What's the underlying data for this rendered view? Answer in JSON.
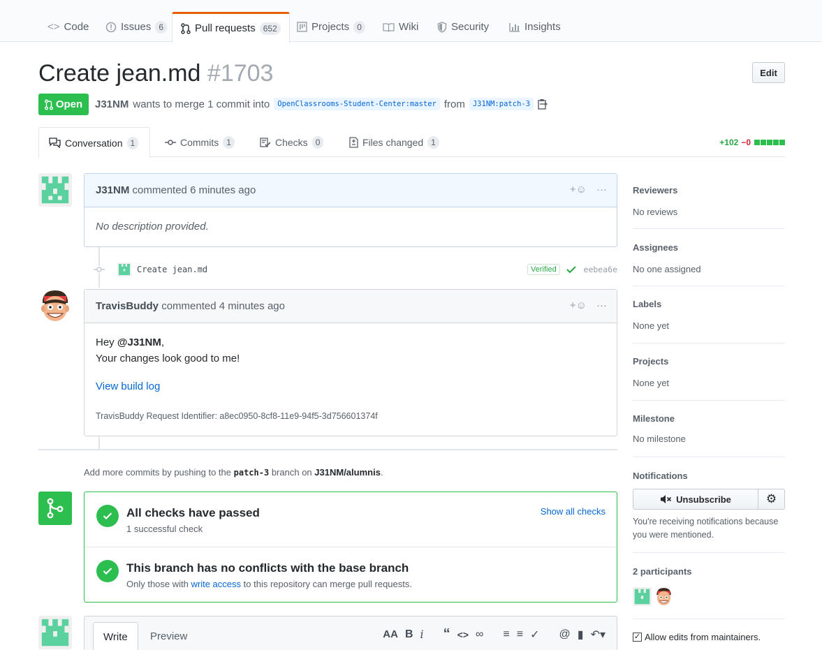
{
  "repo_nav": {
    "tabs": [
      {
        "label": "Code",
        "count": ""
      },
      {
        "label": "Issues",
        "count": "6"
      },
      {
        "label": "Pull requests",
        "count": "652"
      },
      {
        "label": "Projects",
        "count": "0"
      },
      {
        "label": "Wiki",
        "count": ""
      },
      {
        "label": "Security",
        "count": ""
      },
      {
        "label": "Insights",
        "count": ""
      }
    ],
    "selected": "Pull requests",
    "accent_color": "#e36209"
  },
  "pr": {
    "title": "Create jean.md",
    "number": "#1703",
    "edit_label": "Edit",
    "state": "Open",
    "author": "J31NM",
    "meta_text": "wants to merge 1 commit into",
    "base_ref": "OpenClassrooms-Student-Center:master",
    "from_text": "from",
    "head_ref": "J31NM:patch-3"
  },
  "pr_tabs": [
    {
      "label": "Conversation",
      "count": "1"
    },
    {
      "label": "Commits",
      "count": "1"
    },
    {
      "label": "Checks",
      "count": "0"
    },
    {
      "label": "Files changed",
      "count": "1"
    }
  ],
  "diffstat": {
    "additions": "+102",
    "deletions": "−0"
  },
  "timeline": {
    "comment1": {
      "author": "J31NM",
      "time": "commented 6 minutes ago",
      "body": "No description provided."
    },
    "commit": {
      "message": "Create jean.md",
      "verified": "Verified",
      "sha": "eebea6e"
    },
    "comment2": {
      "author": "TravisBuddy",
      "time": "commented 4 minutes ago",
      "greeting": "Hey",
      "mention": "@J31NM",
      "greeting_end": ",",
      "line2": "Your changes look good to me!",
      "link": "View build log",
      "identifier": "TravisBuddy Request Identifier: a8ec0950-8cf8-11e9-94f5-3d756601374f"
    },
    "push_hint": {
      "prefix": "Add more commits by pushing to the",
      "branch": "patch-3",
      "middle": "branch on",
      "repo": "J31NM/alumnis",
      "suffix": "."
    }
  },
  "merge": {
    "checks_title": "All checks have passed",
    "checks_sub": "1 successful check",
    "show_all": "Show all checks",
    "conflict_title": "This branch has no conflicts with the base branch",
    "conflict_sub_prefix": "Only those with",
    "conflict_sub_link": "write access",
    "conflict_sub_suffix": "to this repository can merge pull requests.",
    "status_color": "#2cbe4e"
  },
  "sidebar": {
    "reviewers": {
      "heading": "Reviewers",
      "value": "No reviews"
    },
    "assignees": {
      "heading": "Assignees",
      "value": "No one assigned"
    },
    "labels": {
      "heading": "Labels",
      "value": "None yet"
    },
    "projects": {
      "heading": "Projects",
      "value": "None yet"
    },
    "milestone": {
      "heading": "Milestone",
      "value": "No milestone"
    },
    "notifications": {
      "heading": "Notifications",
      "unsubscribe": "Unsubscribe",
      "reason": "You're receiving notifications because you were mentioned."
    },
    "participants": "2 participants",
    "allow_edits": "Allow edits from maintainers."
  },
  "write": {
    "write_tab": "Write",
    "preview_tab": "Preview"
  }
}
